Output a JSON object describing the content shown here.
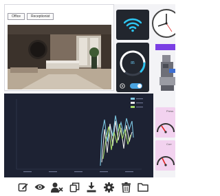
{
  "camera": {
    "tabs": [
      "Office",
      "Receptionist"
    ],
    "active_tab": "Receptionist"
  },
  "gauge": {
    "value": "85"
  },
  "colors": {
    "tile_bg": "#22262e",
    "accent_cyan": "#2ec4f0",
    "purple": "#7b3fe4",
    "chart_bg": "#1d2233",
    "mini_card_bg": "#f2d2ef"
  },
  "mini_cards": [
    {
      "title": "Press"
    },
    {
      "title": "Curr"
    }
  ],
  "chart_data": {
    "type": "line",
    "series": [
      {
        "color": "#7ec8e3"
      },
      {
        "color": "#e8e8e8"
      },
      {
        "color": "#a6d96a"
      }
    ],
    "legend_position": "top-right",
    "x_tick_labels": [
      "",
      "",
      "",
      "",
      ""
    ]
  },
  "toolbar": {
    "icons": [
      "edit-icon",
      "view-icon",
      "remove-user-icon",
      "copy-icon",
      "download-icon",
      "settings-icon",
      "delete-icon",
      "folder-icon"
    ]
  }
}
